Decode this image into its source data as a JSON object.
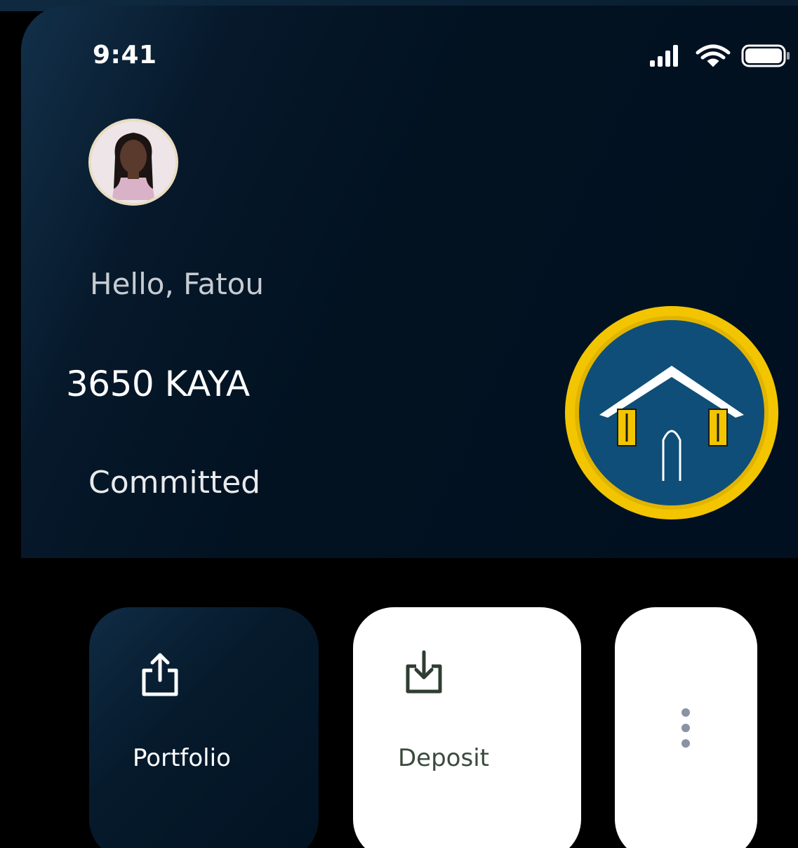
{
  "status_bar": {
    "time": "9:41",
    "icons": [
      "cellular-signal-icon",
      "wifi-icon",
      "battery-icon"
    ]
  },
  "user": {
    "greeting": "Hello, Fatou",
    "balance": "3650 KAYA",
    "status": "Committed"
  },
  "badge": {
    "icon": "house-icon",
    "ring_color": "#f2c500",
    "fill_color": "#0f4e78"
  },
  "actions": [
    {
      "label": "Portfolio",
      "icon": "share-upload-icon"
    },
    {
      "label": "Deposit",
      "icon": "download-tray-icon"
    },
    {
      "label": "",
      "icon": "more-vertical-icon"
    }
  ],
  "colors": {
    "background": "#000000",
    "hero": "#021221",
    "accent": "#f2c500"
  }
}
